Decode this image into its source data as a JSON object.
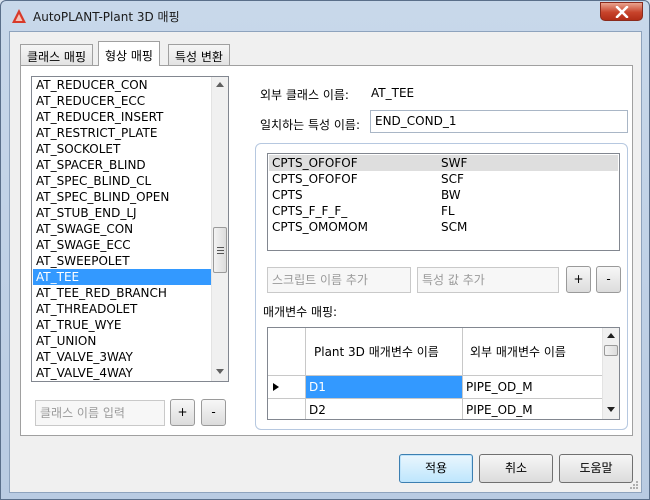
{
  "window": {
    "title": "AutoPLANT-Plant 3D 매핑",
    "close_label": "Close"
  },
  "tabs": [
    {
      "label": "클래스 매핑",
      "active": false
    },
    {
      "label": "형상 매핑",
      "active": true
    },
    {
      "label": "특성 변환",
      "active": false
    }
  ],
  "class_list": {
    "items": [
      "AT_REDUCER_CON",
      "AT_REDUCER_ECC",
      "AT_REDUCER_INSERT",
      "AT_RESTRICT_PLATE",
      "AT_SOCKOLET",
      "AT_SPACER_BLIND",
      "AT_SPEC_BLIND_CL",
      "AT_SPEC_BLIND_OPEN",
      "AT_STUB_END_LJ",
      "AT_SWAGE_CON",
      "AT_SWAGE_ECC",
      "AT_SWEEPOLET",
      "AT_TEE",
      "AT_TEE_RED_BRANCH",
      "AT_THREADOLET",
      "AT_TRUE_WYE",
      "AT_UNION",
      "AT_VALVE_3WAY",
      "AT_VALVE_4WAY"
    ],
    "selected": "AT_TEE",
    "new_class_placeholder": "클래스 이름 입력",
    "add_label": "+",
    "remove_label": "-"
  },
  "mapping": {
    "external_class_label": "외부 클래스 이름:",
    "external_class_value": "AT_TEE",
    "matching_attr_label": "일치하는 특성 이름:",
    "matching_attr_value": "END_COND_1",
    "attr_values": [
      {
        "name": "CPTS_OFOFOF",
        "value": "SWF"
      },
      {
        "name": "CPTS_OFOFOF",
        "value": "SCF"
      },
      {
        "name": "CPTS",
        "value": "BW"
      },
      {
        "name": "CPTS_F_F_F_",
        "value": "FL"
      },
      {
        "name": "CPTS_OMOMOM",
        "value": "SCM"
      }
    ],
    "script_name_placeholder": "스크립트 이름 추가",
    "attr_value_placeholder": "특성 값 추가",
    "add_label": "+",
    "remove_label": "-",
    "param_mapping_label": "매개변수 매핑:",
    "param_grid": {
      "headers": [
        "Plant 3D 매개변수 이름",
        "외부 매개변수 이름"
      ],
      "rows": [
        {
          "plant3d": "D1",
          "external": "PIPE_OD_M"
        },
        {
          "plant3d": "D2",
          "external": "PIPE_OD_M"
        }
      ]
    }
  },
  "buttons": {
    "apply": "적용",
    "cancel": "취소",
    "help": "도움말"
  },
  "colors": {
    "selection": "#3399ff",
    "title_bar": "#c8d8ea",
    "close_button": "#c7432b"
  }
}
